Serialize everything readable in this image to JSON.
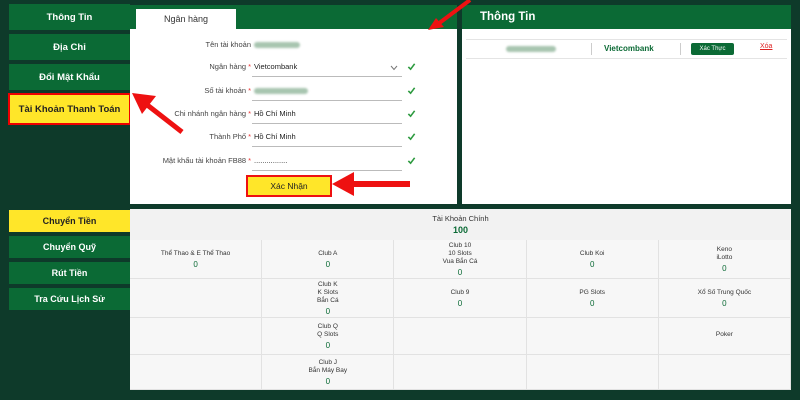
{
  "sidebar_top": {
    "items": [
      "Thông Tin",
      "Địa Chỉ",
      "Đổi Mật Khẩu",
      "Tài Khoản Thanh Toán"
    ],
    "active_index": 3
  },
  "bank_form": {
    "tab": "Ngân hàng",
    "fields": [
      {
        "label": "Tên tài khoản",
        "required": false,
        "value": ""
      },
      {
        "label": "Ngân hàng",
        "required": true,
        "value": "Vietcombank"
      },
      {
        "label": "Số tài khoản",
        "required": true,
        "value": ""
      },
      {
        "label": "Chi nhánh ngân hàng",
        "required": true,
        "value": "Hồ Chí Minh"
      },
      {
        "label": "Thành Phố",
        "required": true,
        "value": "Hồ Chí Minh"
      },
      {
        "label": "Mật khẩu tài khoản FB88",
        "required": true,
        "value": "................"
      }
    ],
    "submit_label": "Xác Nhận"
  },
  "info_panel": {
    "title": "Thông Tin",
    "bank": "Vietcombank",
    "verify_label": "Xác Thực",
    "delete_label": "Xóa"
  },
  "sidebar_bottom": {
    "items": [
      "Chuyển Tiền",
      "Chuyển Quỹ",
      "Rút Tiền",
      "Tra Cứu Lịch Sử"
    ],
    "active_index": 0
  },
  "wallet": {
    "main_title": "Tài Khoản Chính",
    "main_balance": "100",
    "cells": [
      {
        "name": "Thể Thao & E Thể Thao",
        "balance": "0"
      },
      {
        "name": "Club A",
        "balance": "0"
      },
      {
        "name": "Club 10\n10 Slots\nVua Bắn Cá",
        "balance": "0"
      },
      {
        "name": "Club Koi",
        "balance": "0"
      },
      {
        "name": "Keno\niLotto",
        "balance": "0"
      },
      {
        "name": "",
        "balance": ""
      },
      {
        "name": "Club K\nK Slots\nBắn Cá",
        "balance": "0"
      },
      {
        "name": "Club 9",
        "balance": "0"
      },
      {
        "name": "PG Slots",
        "balance": "0"
      },
      {
        "name": "Xổ Số Trung Quốc",
        "balance": "0"
      },
      {
        "name": "",
        "balance": ""
      },
      {
        "name": "Club Q\nQ Slots",
        "balance": "0"
      },
      {
        "name": "",
        "balance": ""
      },
      {
        "name": "",
        "balance": ""
      },
      {
        "name": "Poker",
        "balance": ""
      },
      {
        "name": "",
        "balance": ""
      },
      {
        "name": "Club J\nBắn Máy Bay",
        "balance": "0"
      },
      {
        "name": "",
        "balance": ""
      },
      {
        "name": "",
        "balance": ""
      },
      {
        "name": "",
        "balance": ""
      }
    ]
  },
  "colors": {
    "brand_green": "#0b6a35",
    "highlight_yellow": "#ffe629",
    "annotation_red": "#e11111"
  }
}
